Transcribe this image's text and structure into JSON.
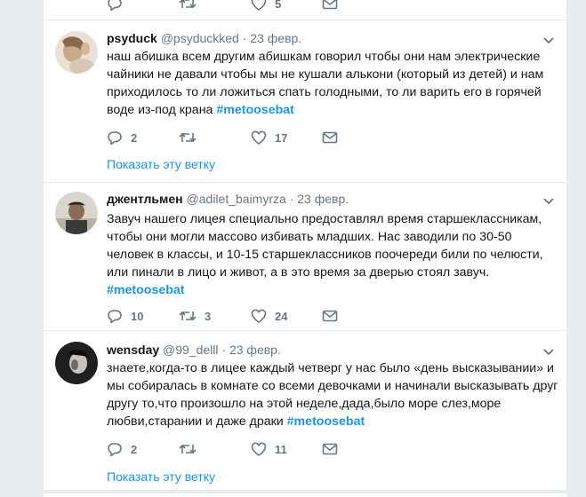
{
  "top_actions": {
    "like_count": "5"
  },
  "tweets": [
    {
      "name": "psyduck",
      "handle": "@psyduckked",
      "date": "· 23 февр.",
      "text": "наш абишка всем другим абишкам говорил чтобы они нам электрические чайники не давали чтобы мы не кушали алькони (который из детей) и нам приходилось то ли ложиться спать голодными, то ли варить его в горячей воде из-под крана ",
      "hashtag": "#metoosebat",
      "reply_count": "2",
      "retweet_count": "",
      "like_count": "17",
      "show_thread": "Показать эту ветку"
    },
    {
      "name": "джентльмен",
      "handle": "@adilet_baimyrza",
      "date": "· 23 февр.",
      "text": "Завуч нашего лицея специально предоставлял время старшеклассникам, чтобы они могли массово избивать младших. Нас заводили по 30-50 человек в классы, и 10-15 старшеклассников поочереди били по челюсти, или пинали в лицо и живот, а в это время за дверью стоял завуч.",
      "hashtag": "#metoosebat",
      "reply_count": "10",
      "retweet_count": "3",
      "like_count": "24",
      "show_thread": ""
    },
    {
      "name": "wensday",
      "handle": "@99_delll",
      "date": "· 23 февр.",
      "text": "знаете,когда-то в лицее каждый четверг у нас было «день высказывании» и мы собиралась в комнате со всеми девочками и начинали высказывать друг другу то,что произошло на этой неделе,дада,было море слез,море любви,старании и даже драки ",
      "hashtag": "#metoosebat",
      "reply_count": "2",
      "retweet_count": "",
      "like_count": "11",
      "show_thread": "Показать эту ветку"
    }
  ],
  "colors": {
    "accent": "#1b95e0",
    "muted": "#657786",
    "background": "#e6ecf0"
  },
  "icons": [
    "reply-icon",
    "retweet-icon",
    "like-icon",
    "message-icon",
    "chevron-down-icon"
  ]
}
